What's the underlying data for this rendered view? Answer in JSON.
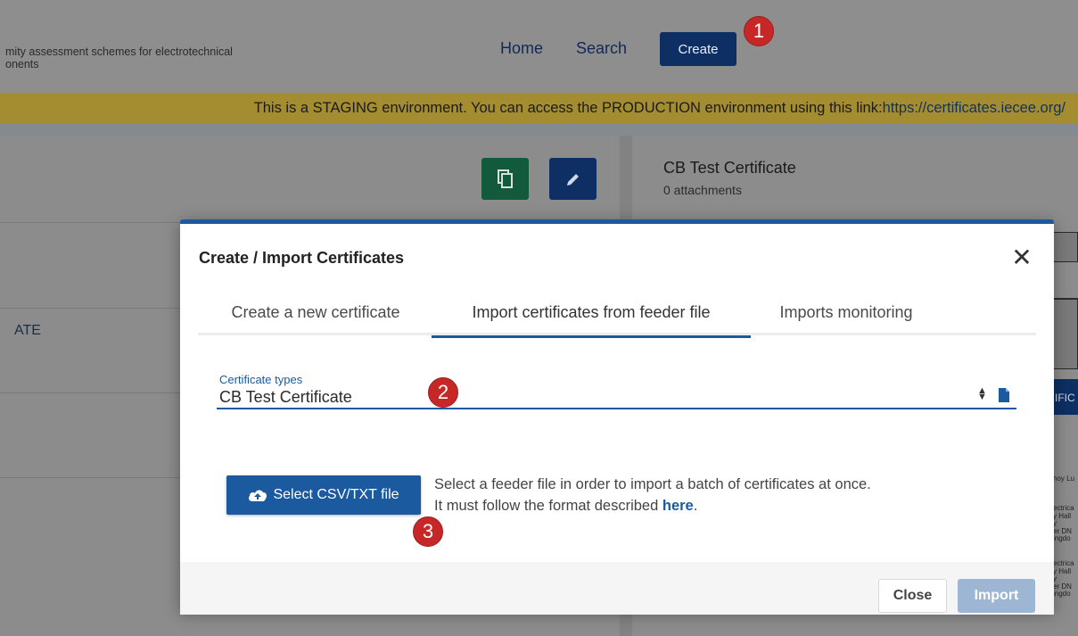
{
  "header": {
    "brand_line1": "mity assessment schemes for electrotechnical",
    "brand_line2": "onents",
    "nav": {
      "home": "Home",
      "search": "Search",
      "create": "Create"
    }
  },
  "staging_banner": {
    "text": "This is a STAGING environment. You can access the PRODUCTION environment using this link: ",
    "link": "https://certificates.iecee.org/"
  },
  "background": {
    "left_text": "ATE",
    "right_title": "CB Test Certificate",
    "right_subtitle": "0 attachments",
    "right_button_text": "IFIC",
    "right_fragments": [
      "hoy Lu",
      "ectrica",
      "y Hall",
      "y",
      "er DN",
      "ingdo",
      "ectrica",
      "y Hall",
      "y",
      "er DN",
      "ingdo"
    ]
  },
  "modal": {
    "title": "Create / Import Certificates",
    "close_symbol": "✕",
    "tabs": [
      {
        "label": "Create a new certificate",
        "active": false
      },
      {
        "label": "Import certificates from feeder file",
        "active": true
      },
      {
        "label": "Imports monitoring",
        "active": false
      }
    ],
    "certificate_types": {
      "label": "Certificate types",
      "value": "CB Test Certificate"
    },
    "select_file_button": "Select CSV/TXT file",
    "help_line1": "Select a feeder file in order to import a batch of certificates at once.",
    "help_line2_prefix": "It must follow the format described ",
    "help_link": "here",
    "help_line2_suffix": ".",
    "footer": {
      "close": "Close",
      "import": "Import"
    }
  },
  "annotations": {
    "badge1": "1",
    "badge2": "2",
    "badge3": "3"
  },
  "icons": [
    "copy-icon",
    "edit-icon",
    "close-icon",
    "sort-arrows-icon",
    "document-icon",
    "cloud-upload-icon"
  ],
  "colors": {
    "accent": "#1c5aa0",
    "badge": "#c62828",
    "staging": "#a48c31",
    "copy_button": "#125a3b",
    "create_button": "#0d2f63"
  }
}
